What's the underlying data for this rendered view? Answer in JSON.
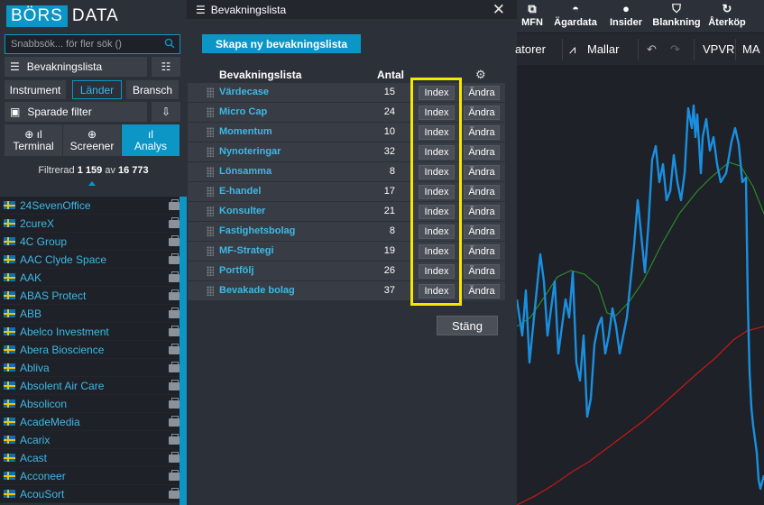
{
  "app": {
    "logo_a": "BÖRS",
    "logo_b": "DATA"
  },
  "sidebar": {
    "search_placeholder": "Snabbsök... för fler sök ()",
    "watchlist_label": "Bevakningslista",
    "filter_tabs": [
      "Instrument",
      "Länder",
      "Bransch"
    ],
    "active_filter_tab": "Länder",
    "saved_filters_label": "Sparade filter",
    "views": [
      "Terminal",
      "Screener",
      "Analys"
    ],
    "active_view": "Analys",
    "filtered_label": "Filtrerad",
    "filtered_count": "1 159",
    "filtered_of": "av",
    "filtered_total": "16 773",
    "companies": [
      "24SevenOffice",
      "2cureX",
      "4C Group",
      "AAC Clyde Space",
      "AAK",
      "ABAS Protect",
      "ABB",
      "Abelco Investment",
      "Abera Bioscience",
      "Abliva",
      "Absolent Air Care",
      "Absolicon",
      "AcadeMedia",
      "Acarix",
      "Acast",
      "Acconeer",
      "AcouSort"
    ]
  },
  "modal": {
    "title": "Bevakningslista",
    "create_label": "Skapa ny bevakningslista",
    "col_name": "Bevakningslista",
    "col_count": "Antal",
    "index_label": "Index",
    "change_label": "Ändra",
    "close_label": "Stäng",
    "lists": [
      {
        "name": "Värdecase",
        "count": "15"
      },
      {
        "name": "Micro Cap",
        "count": "24"
      },
      {
        "name": "Momentum",
        "count": "10"
      },
      {
        "name": "Nynoteringar",
        "count": "32"
      },
      {
        "name": "Lönsamma",
        "count": "8"
      },
      {
        "name": "E-handel",
        "count": "17"
      },
      {
        "name": "Konsulter",
        "count": "21"
      },
      {
        "name": "Fastighetsbolag",
        "count": "8"
      },
      {
        "name": "MF-Strategi",
        "count": "19"
      },
      {
        "name": "Portfölj",
        "count": "26"
      },
      {
        "name": "Bevakade bolag",
        "count": "37"
      }
    ]
  },
  "right": {
    "topnav": [
      "MFN",
      "Ägardata",
      "Insider",
      "Blankning",
      "Återköp"
    ],
    "tools": {
      "indicators": "atorer",
      "templates": "Mallar",
      "vpvr": "VPVR",
      "ma": "MA"
    }
  },
  "colors": {
    "accent": "#0b96c6",
    "link": "#3fb8e6",
    "highlight": "#f6e700",
    "price_line": "#1a8fe0",
    "ma_short": "#2a8a2a",
    "ma_long": "#c01818"
  }
}
